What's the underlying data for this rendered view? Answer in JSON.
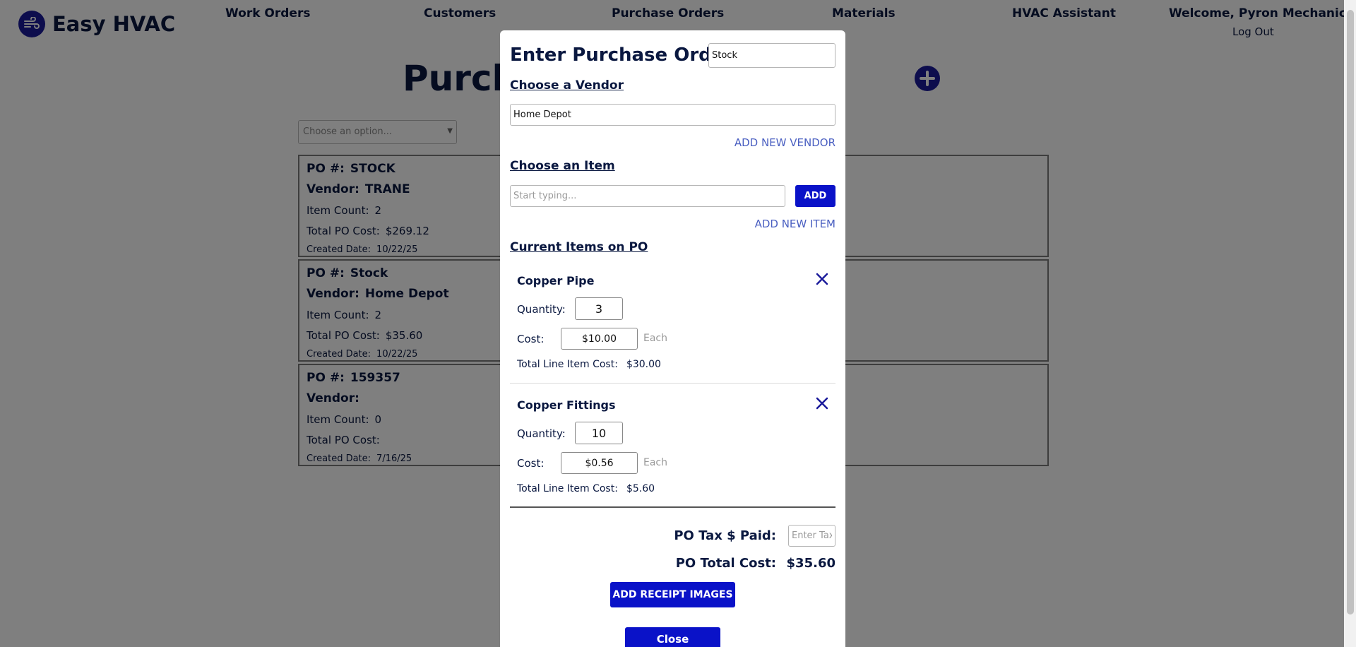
{
  "app": {
    "name": "Easy HVAC"
  },
  "nav": {
    "work_orders": "Work Orders",
    "customers": "Customers",
    "purchase_orders": "Purchase Orders",
    "materials": "Materials",
    "assistant": "HVAC Assistant",
    "welcome": "Welcome, Pyron Mechanical",
    "logout": "Log Out"
  },
  "page": {
    "title": "Purcha",
    "filter_placeholder": "Choose an option...",
    "po_labels": {
      "po": "PO #:",
      "vendor": "Vendor:",
      "item_count": "Item Count:",
      "total": "Total PO Cost:",
      "created": "Created Date:"
    },
    "purchase_orders": [
      {
        "po": "STOCK",
        "vendor": "TRANE",
        "item_count": "2",
        "total": "$269.12",
        "created": "10/22/25"
      },
      {
        "po": "Stock",
        "vendor": "Home Depot",
        "item_count": "2",
        "total": "$35.60",
        "created": "10/22/25"
      },
      {
        "po": "159357",
        "vendor": "",
        "item_count": "0",
        "total": "",
        "created": "7/16/25"
      }
    ]
  },
  "modal": {
    "title": "Enter Purchase Order #",
    "po_number": "Stock",
    "vendor_heading": "Choose a Vendor",
    "vendor_value": "Home Depot",
    "add_vendor": "ADD NEW VENDOR",
    "item_heading": "Choose an Item",
    "item_placeholder": "Start typing...",
    "add_button": "ADD",
    "add_item": "ADD NEW ITEM",
    "current_heading": "Current Items on PO",
    "labels": {
      "quantity": "Quantity:",
      "cost": "Cost:",
      "each": "Each",
      "line_total": "Total Line Item Cost:"
    },
    "items": [
      {
        "name": "Copper Pipe",
        "quantity": "3",
        "cost": "$10.00",
        "line_total": "$30.00"
      },
      {
        "name": "Copper Fittings",
        "quantity": "10",
        "cost": "$0.56",
        "line_total": "$5.60"
      }
    ],
    "tax_label": "PO Tax $ Paid:",
    "tax_placeholder": "Enter Tax",
    "total_label": "PO Total Cost:",
    "total_value": "$35.60",
    "receipt_button": "ADD RECEIPT IMAGES",
    "close_button": "Close"
  },
  "colors": {
    "brand_navy": "#0a1840",
    "primary_button": "#0a12c8",
    "link": "#4a5fc1",
    "icon_blue": "#1a1a9a"
  }
}
